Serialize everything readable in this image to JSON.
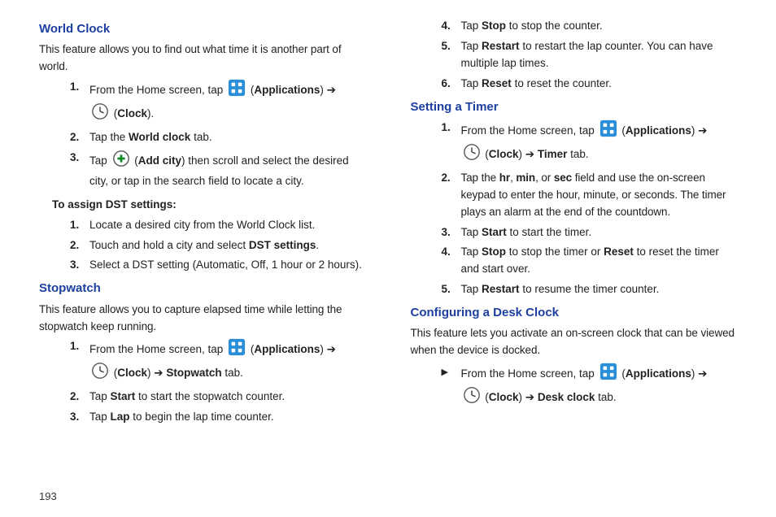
{
  "pageNumber": "193",
  "worldClock": {
    "heading": "World Clock",
    "intro": "This feature allows you to find out what time it is another part of world.",
    "step1a": "From the Home screen, tap ",
    "step1_apps": "Applications",
    "step1_clock": "Clock",
    "step2a": "Tap the ",
    "step2b": "World clock",
    "step2c": " tab.",
    "step3a": "Tap ",
    "step3b": "Add city",
    "step3c": ") then scroll and select the desired city, or tap in the search field to locate a city.",
    "dstHead": "To assign DST settings:",
    "dst1": "Locate a desired city from the World Clock list.",
    "dst2a": "Touch and hold a city and select ",
    "dst2b": "DST settings",
    "dst3": "Select a DST setting (Automatic, Off, 1 hour or 2 hours)."
  },
  "stopwatch": {
    "heading": "Stopwatch",
    "intro": "This feature allows you to capture elapsed time while letting the stopwatch keep running.",
    "step1a": "From the Home screen, tap ",
    "step1_apps": "Applications",
    "step1_clock": "Clock",
    "step1_stopwatch": "Stopwatch",
    "step1_tab": " tab.",
    "step2a": "Tap ",
    "step2b": "Start",
    "step2c": " to start the stopwatch counter.",
    "step3a": "Tap ",
    "step3b": "Lap",
    "step3c": " to begin the lap time counter.",
    "step4a": "Tap ",
    "step4b": "Stop",
    "step4c": " to stop the counter.",
    "step5a": "Tap ",
    "step5b": "Restart",
    "step5c": " to restart the lap counter. You can have multiple lap times.",
    "step6a": "Tap ",
    "step6b": "Reset",
    "step6c": " to reset the counter."
  },
  "timer": {
    "heading": "Setting a Timer",
    "step1a": "From the Home screen, tap ",
    "step1_apps": "Applications",
    "step1_clock": "Clock",
    "step1_timer": "Timer",
    "step1_tab": " tab.",
    "step2a": "Tap the ",
    "step2_hr": "hr",
    "step2_min": "min",
    "step2_sec": "sec",
    "step2b": ", or ",
    "step2c": " field and use the on-screen keypad to enter the hour, minute, or seconds. The timer plays an alarm at the end of the countdown.",
    "step3a": "Tap ",
    "step3b": "Start",
    "step3c": " to start the timer.",
    "step4a": "Tap ",
    "step4b": "Stop",
    "step4c": " to stop the timer or ",
    "step4d": "Reset",
    "step4e": " to reset the timer and start over.",
    "step5a": "Tap ",
    "step5b": "Restart",
    "step5c": " to resume the timer counter."
  },
  "desk": {
    "heading": "Configuring a Desk Clock",
    "intro": "This feature lets you activate an on-screen clock that can be viewed when the device is docked.",
    "step1a": "From the Home screen, tap ",
    "step1_apps": "Applications",
    "step1_clock": "Clock",
    "step1_deskclock": "Desk clock",
    "step1_tab": " tab."
  }
}
